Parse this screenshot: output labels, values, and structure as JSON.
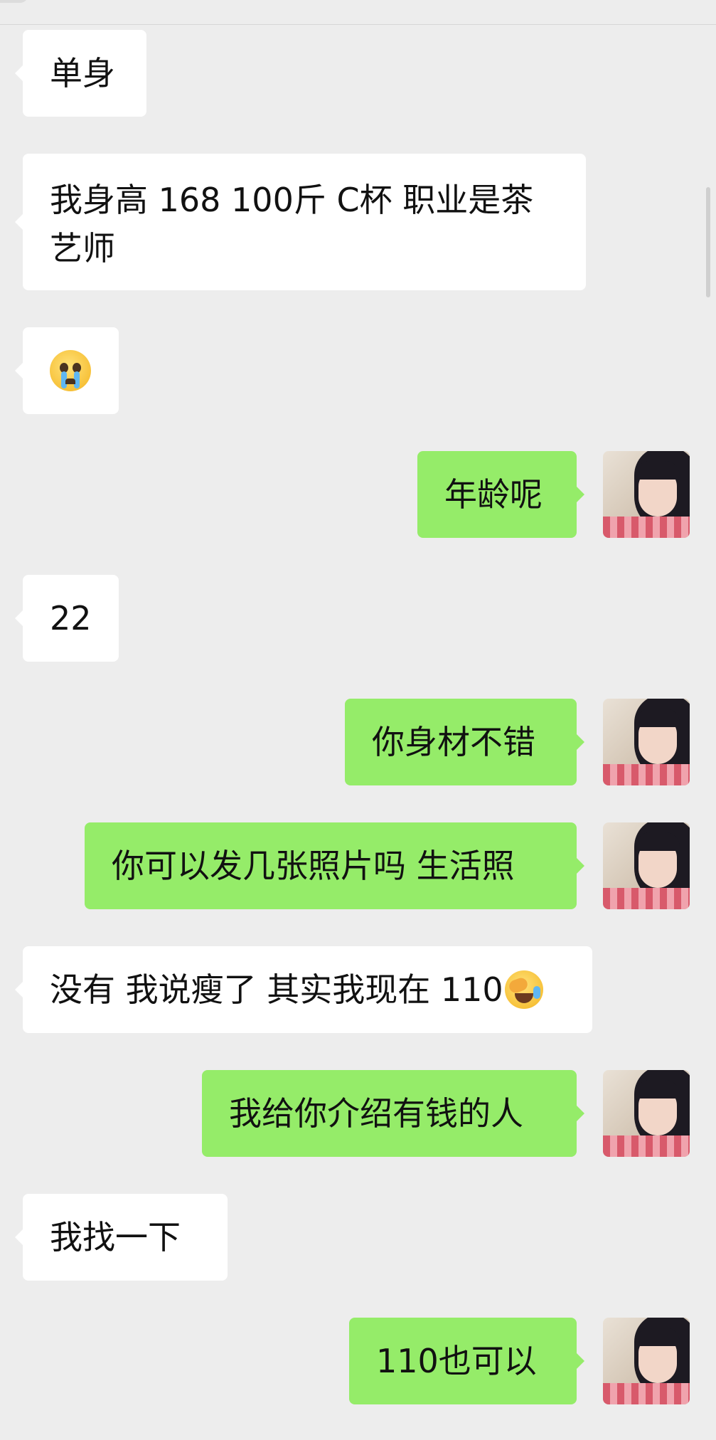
{
  "messages": [
    {
      "side": "left",
      "text": "单身"
    },
    {
      "side": "left",
      "lines": [
        "我身高 168 100斤 C杯 职业是茶",
        "艺师"
      ]
    },
    {
      "side": "left",
      "emoji": "crying-face-emoji"
    },
    {
      "side": "right",
      "text": "年龄呢"
    },
    {
      "side": "left",
      "text": "22"
    },
    {
      "side": "right",
      "text": "你身材不错"
    },
    {
      "side": "right",
      "text": "你可以发几张照片吗 生活照"
    },
    {
      "side": "left",
      "text": "没有 我说瘦了 其实我现在 110",
      "trailing_emoji": "laughing-face-palm-emoji"
    },
    {
      "side": "right",
      "text": "我给你介绍有钱的人"
    },
    {
      "side": "left",
      "text": "我找一下"
    },
    {
      "side": "right",
      "text": "110也可以"
    }
  ],
  "colors": {
    "background": "#ededed",
    "incoming_bubble": "#ffffff",
    "outgoing_bubble": "#95ec69",
    "text": "#111111"
  },
  "avatar": {
    "icon": "user-avatar-photo"
  }
}
